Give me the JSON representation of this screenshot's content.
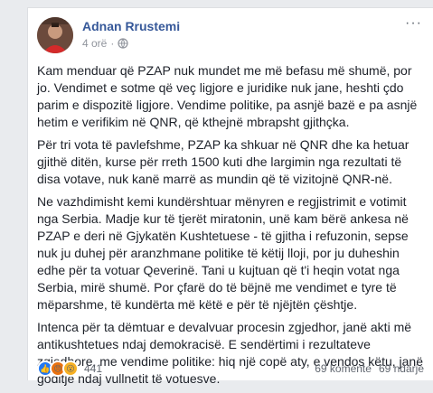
{
  "post": {
    "author": "Adnan Rrustemi",
    "time": "4 orë",
    "more_icon": "more-icon",
    "privacy_icon": "globe-icon",
    "paragraphs": [
      "Kam menduar që PZAP nuk mundet me më befasu më shumë, por jo. Vendimet e sotme që veç ligjore e juridike nuk jane, heshti çdo parim e dispozitë ligjore. Vendime politike, pa asnjë bazë e pa asnjë hetim e verifikim në QNR, që kthejnë mbrapsht gjithçka.",
      "Për tri vota të pavlefshme, PZAP ka shkuar në QNR dhe ka hetuar gjithë ditën, kurse për rreth 1500 kuti dhe largimin nga rezultati të disa votave, nuk kanë marrë as mundin që të vizitojnë QNR-në.",
      "Ne vazhdimisht kemi kundërshtuar mënyren e regjistrimit e votimit nga Serbia. Madje kur të tjerët miratonin, unë kam bërë ankesa në PZAP e deri në Gjykatën Kushtetuese - të gjitha i refuzonin, sepse nuk ju duhej për aranzhmane politike të këtij lloji, por ju duheshin edhe për ta votuar Qeverinë. Tani u kujtuan që t'i heqin votat nga Serbia, mirë shumë. Por çfarë do të bëjnë me vendimet e tyre të mëparshme, të kundërta më këtë e për të njëjtën çështje.",
      "Intenca për ta dëmtuar e devalvuar procesin zgjedhor, janë akti më antikushtetues ndaj demokracisë. E sendërtimi i rezultateve zgjedhore, me vendime politike: hiq një copë aty, e vendos këtu, janë goditje ndaj vullnetit të votuesve."
    ]
  },
  "footer": {
    "reaction_count": "441",
    "comments": "69 komente",
    "shares": "69 ndarje",
    "reactions": [
      "like-icon",
      "angry-icon",
      "wow-icon"
    ]
  },
  "colors": {
    "author": "#365899",
    "like": "#2078f4",
    "angry": "#e9710f",
    "wow": "#f7b125"
  }
}
